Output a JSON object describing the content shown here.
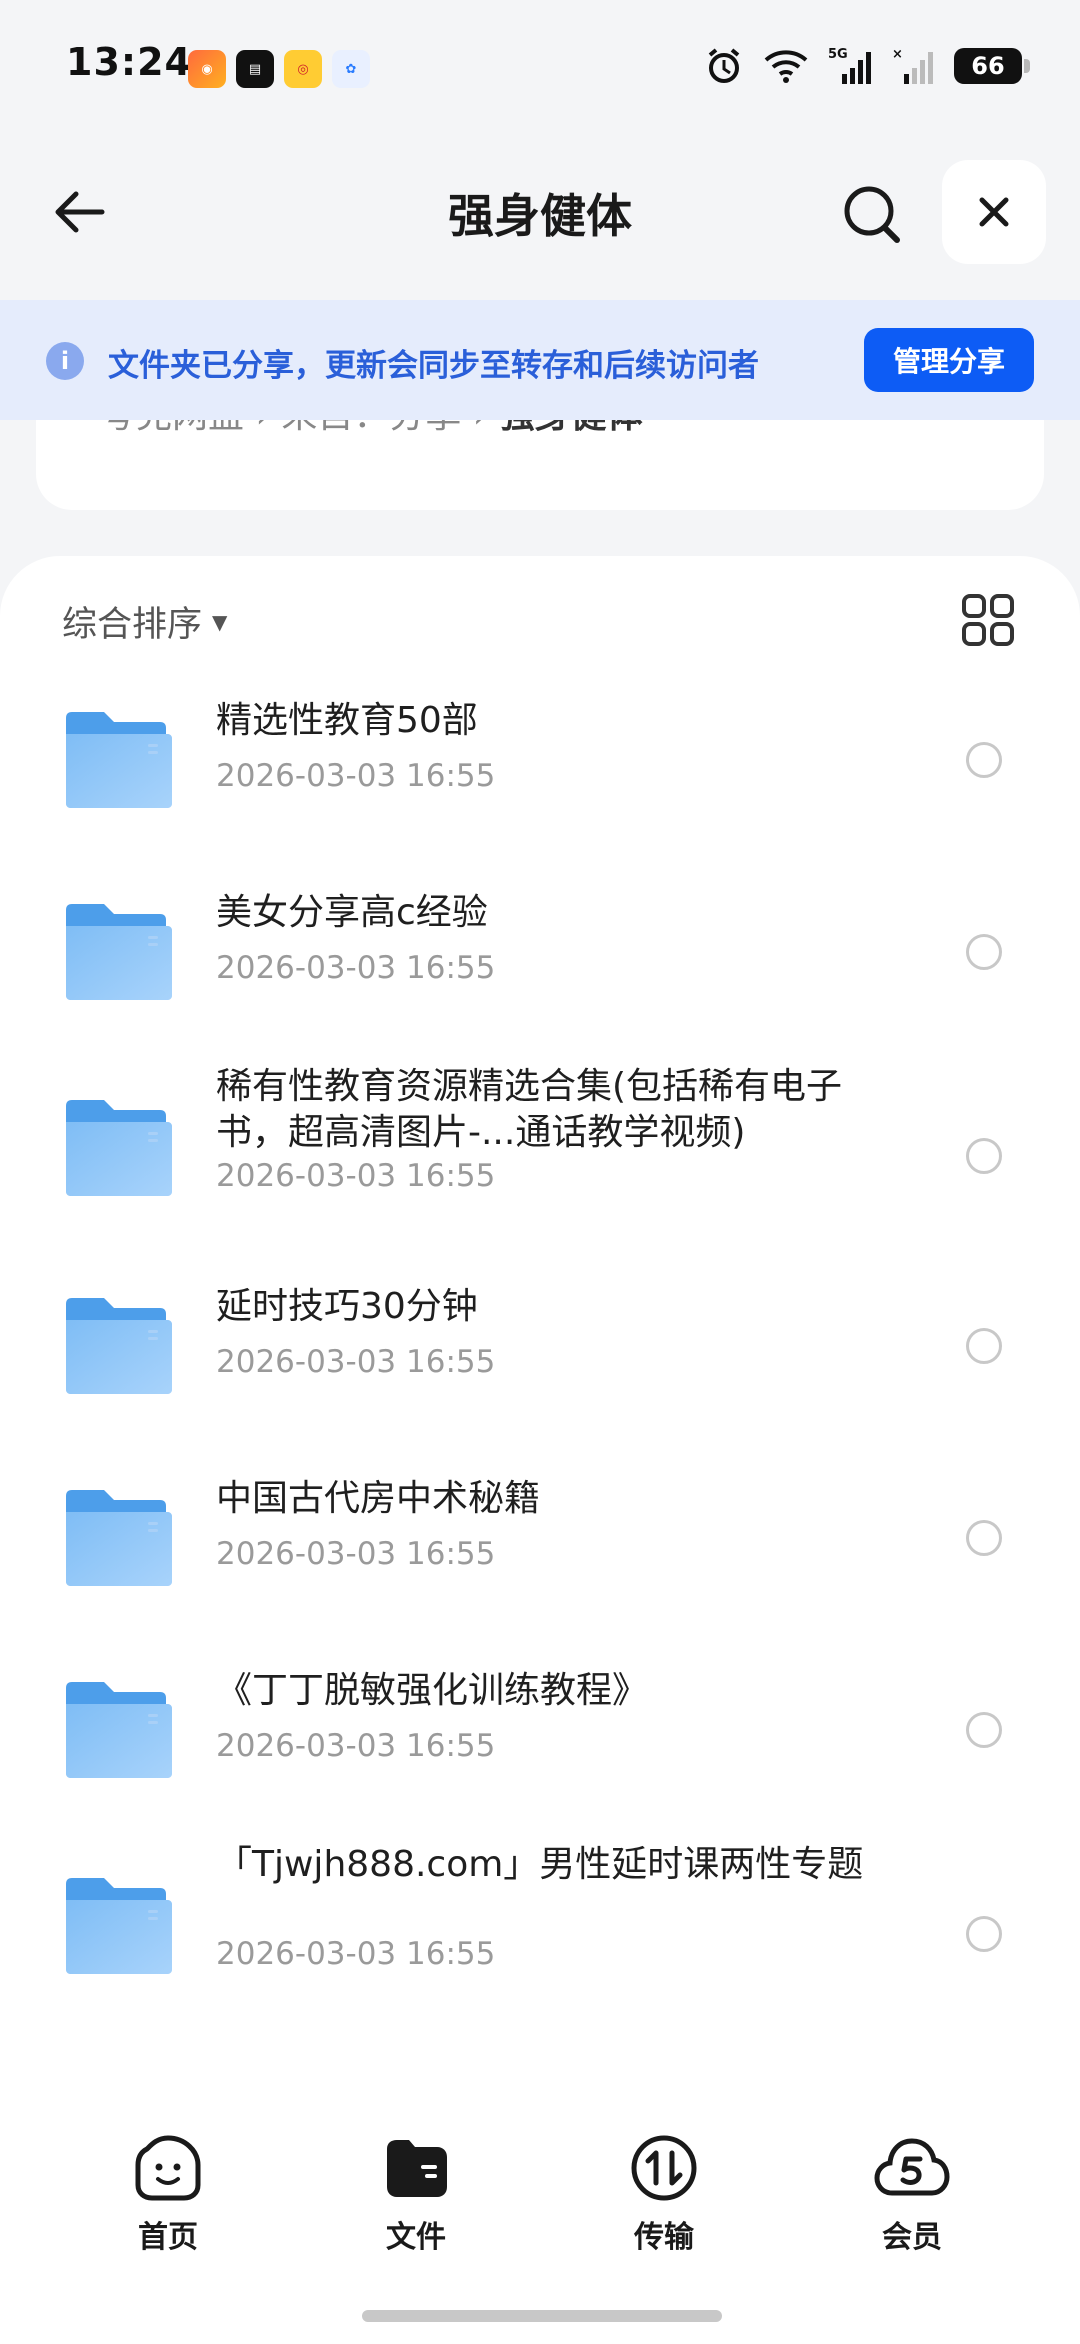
{
  "status_bar": {
    "time": "13:24",
    "battery": "66",
    "notif_apps": [
      "app-notif-1",
      "app-notif-2",
      "weibo-notif",
      "app-notif-4"
    ]
  },
  "header": {
    "title": "强身健体"
  },
  "banner": {
    "text": "文件夹已分享，更新会同步至转存和后续访问者",
    "button": "管理分享",
    "accent": "#0d5cf5"
  },
  "breadcrumb": {
    "root": "夸克网盘",
    "middle": "来自：分享",
    "current": "强身健体"
  },
  "toolbar": {
    "sort_label": "综合排序"
  },
  "files": [
    {
      "name": "精选性教育50部",
      "date": "2026-03-03 16:55"
    },
    {
      "name": "美女分享高c经验",
      "date": "2026-03-03 16:55"
    },
    {
      "name": "稀有性教育资源精选合集(包括稀有电子书，超高清图片-...通话教学视频)",
      "date": "2026-03-03 16:55"
    },
    {
      "name": "延时技巧30分钟",
      "date": "2026-03-03 16:55"
    },
    {
      "name": "中国古代房中术秘籍",
      "date": "2026-03-03 16:55"
    },
    {
      "name": "《丁丁脱敏强化训练教程》",
      "date": "2026-03-03 16:55"
    },
    {
      "name": "「Tjwjh888.com」男性延时课两性专题",
      "date": "2026-03-03 16:55"
    }
  ],
  "nav": [
    {
      "label": "首页",
      "icon": "home-face-icon"
    },
    {
      "label": "文件",
      "icon": "folder-nav-icon"
    },
    {
      "label": "传输",
      "icon": "transfer-icon"
    },
    {
      "label": "会员",
      "icon": "member-cloud-icon"
    }
  ]
}
